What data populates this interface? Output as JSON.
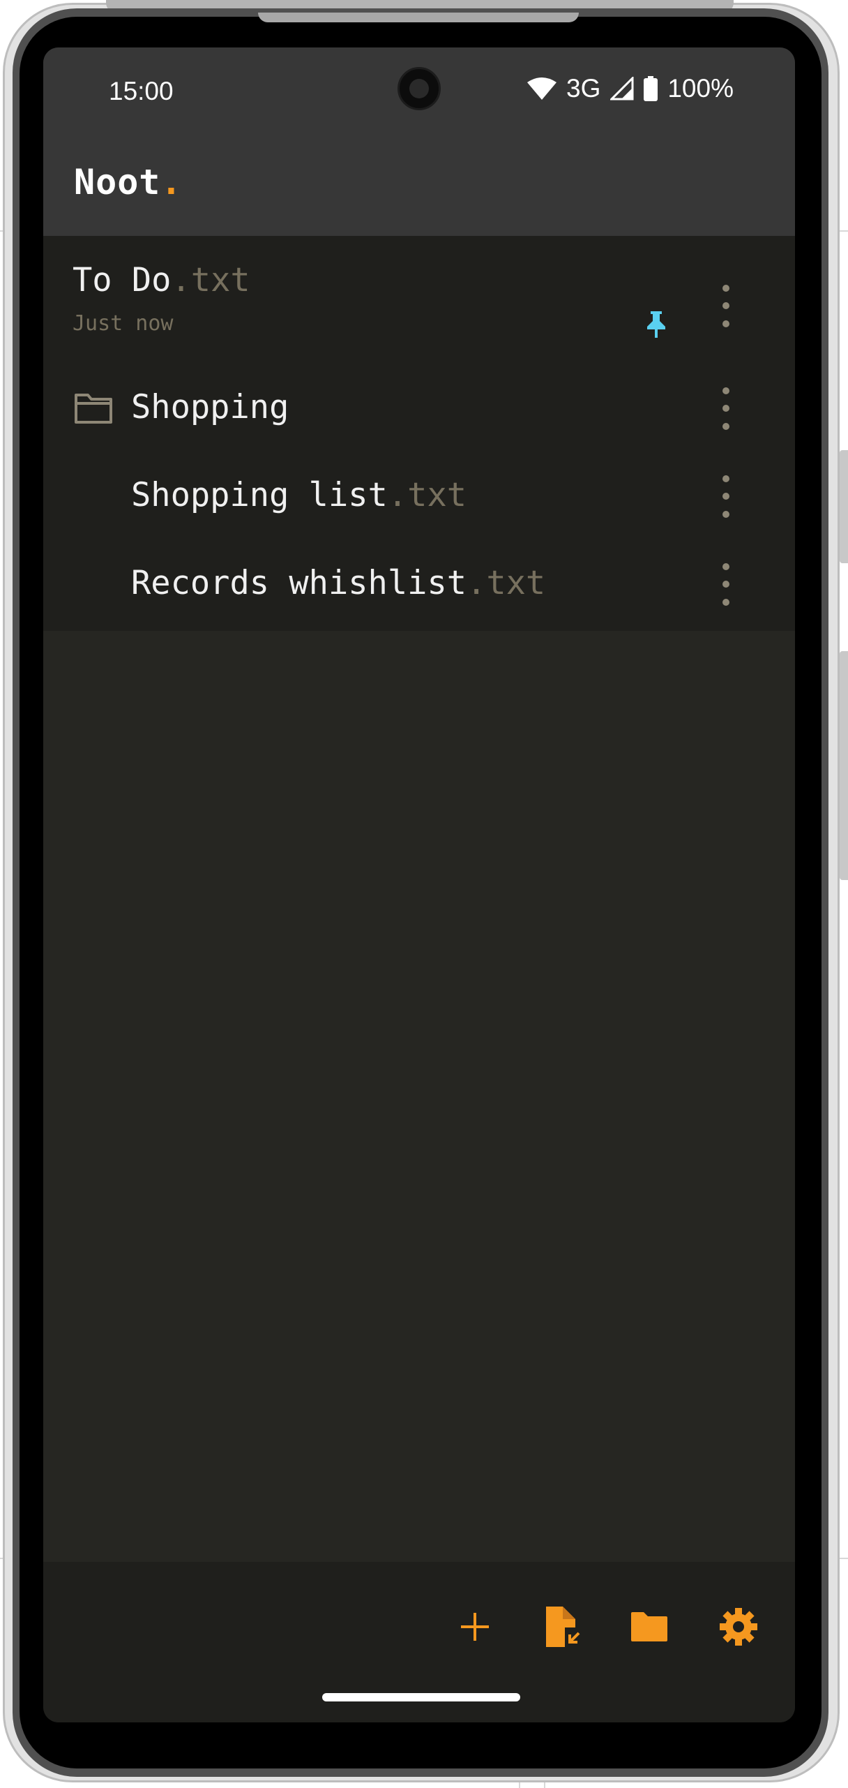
{
  "status_bar": {
    "time": "15:00",
    "network": "3G",
    "battery": "100%"
  },
  "app": {
    "title": "Noot",
    "title_dot": "."
  },
  "items": [
    {
      "type": "note",
      "name": "To Do",
      "ext": ".txt",
      "subtitle": "Just now",
      "pinned": true
    },
    {
      "type": "folder",
      "name": "Shopping"
    },
    {
      "type": "note",
      "name": "Shopping list",
      "ext": ".txt",
      "indented": true
    },
    {
      "type": "note",
      "name": "Records whishlist",
      "ext": ".txt",
      "indented": true
    }
  ],
  "bottom_actions": [
    {
      "icon": "plus-icon"
    },
    {
      "icon": "file-import-icon"
    },
    {
      "icon": "folder-icon"
    },
    {
      "icon": "gear-icon"
    }
  ],
  "colors": {
    "accent": "#f5981f",
    "pin": "#5ad0f0",
    "muted": "#77705e",
    "list_bg": "#1f1f1c",
    "content_bg": "#262622"
  }
}
